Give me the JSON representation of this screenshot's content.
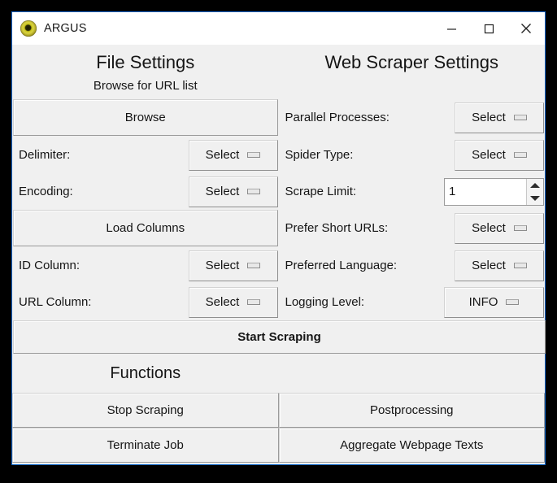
{
  "window": {
    "title": "ARGUS",
    "icon": "eye-icon",
    "accent_border": "#0a64c8",
    "background": "#f0f0f0",
    "controls": {
      "minimize": "minimize-icon",
      "maximize": "maximize-icon",
      "close": "close-icon"
    }
  },
  "file_settings": {
    "heading": "File Settings",
    "subheading": "Browse for URL list",
    "browse_button": "Browse",
    "rows": [
      {
        "label": "Delimiter:",
        "value": "Select",
        "control": "dropdown"
      },
      {
        "label": "Encoding:",
        "value": "Select",
        "control": "dropdown"
      }
    ],
    "load_columns_button": "Load Columns",
    "rows2": [
      {
        "label": "ID Column:",
        "value": "Select",
        "control": "dropdown"
      },
      {
        "label": "URL Column:",
        "value": "Select",
        "control": "dropdown"
      }
    ]
  },
  "web_scraper_settings": {
    "heading": "Web Scraper Settings",
    "rows": [
      {
        "label": "Parallel Processes:",
        "value": "Select",
        "control": "dropdown"
      },
      {
        "label": "Spider Type:",
        "value": "Select",
        "control": "dropdown"
      },
      {
        "label": "Scrape Limit:",
        "value": "1",
        "control": "spinbox"
      },
      {
        "label": "Prefer Short URLs:",
        "value": "Select",
        "control": "dropdown"
      },
      {
        "label": "Preferred Language:",
        "value": "Select",
        "control": "dropdown"
      },
      {
        "label": "Logging Level:",
        "value": "INFO",
        "control": "dropdown"
      }
    ]
  },
  "start_scraping_button": "Start Scraping",
  "functions": {
    "heading": "Functions",
    "buttons": [
      "Stop Scraping",
      "Postprocessing",
      "Terminate Job",
      "Aggregate Webpage Texts"
    ]
  }
}
